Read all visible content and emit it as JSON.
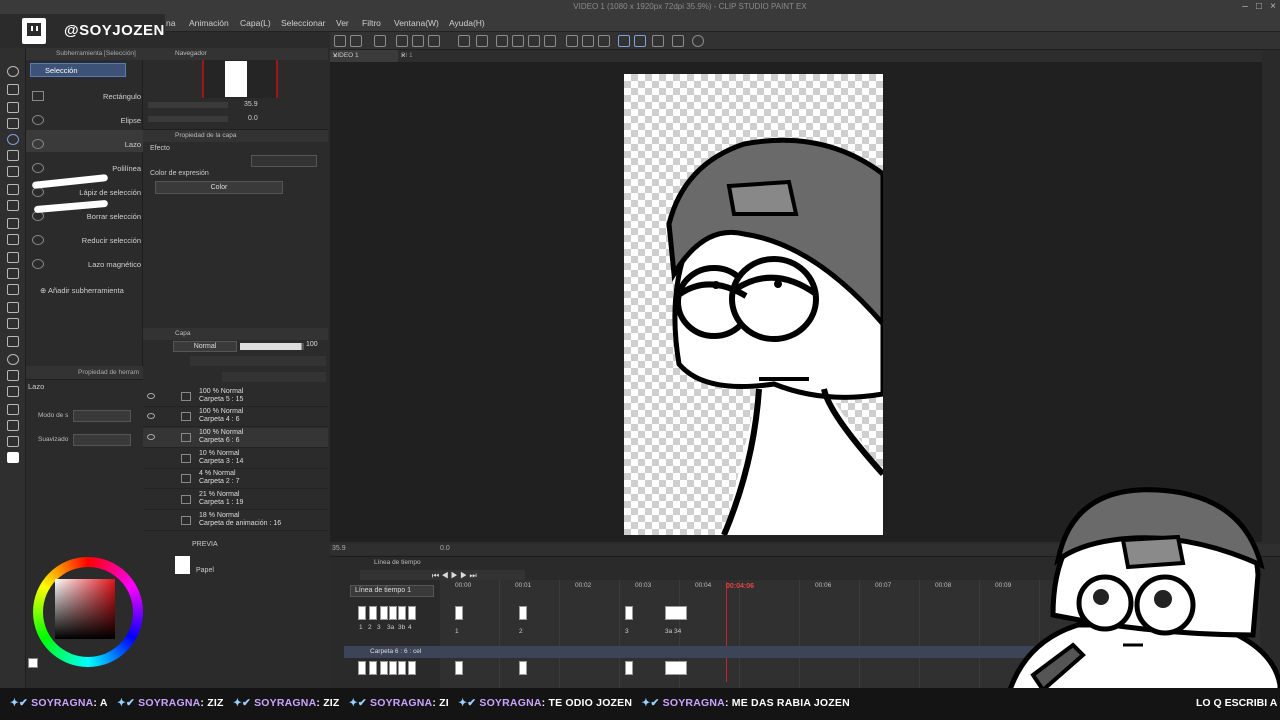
{
  "window": {
    "title": "VIDEO 1 (1080 x 1920px 72dpi 35.9%) - CLIP STUDIO PAINT EX"
  },
  "stream": {
    "handle": "@SOYJOZEN"
  },
  "menu": {
    "items": [
      "na",
      "Animación",
      "Capa(L)",
      "Seleccionar",
      "Ver",
      "Filtro",
      "Ventana(W)",
      "Ayuda(H)"
    ]
  },
  "subtool": {
    "header": "Subherramienta [Selección]",
    "group": "Selección",
    "items": [
      "Rectángulo",
      "Elipse",
      "Lazo",
      "Polilínea",
      "Lápiz de selección",
      "Borrar selección",
      "Reducir selección",
      "Lazo magnético"
    ],
    "add_label": "Añadir subherramienta"
  },
  "tool_property": {
    "header": "Propiedad de herram",
    "tool_name": "Lazo",
    "mode_label": "Modo de sel",
    "smoothing_label": "Suavizado"
  },
  "navigator": {
    "title": "Navegador",
    "zoom": "35.9",
    "rotation": "0.0"
  },
  "layer_property": {
    "title": "Propiedad de la capa",
    "effect_label": "Efecto",
    "expression_color_label": "Color de expresión",
    "expression_color_value": "Color"
  },
  "layers": {
    "title": "Capa",
    "blend_mode": "Normal",
    "opacity": "100",
    "rows": [
      {
        "mode": "100 % Normal",
        "name": "Carpeta 5 : 15"
      },
      {
        "mode": "100 % Normal",
        "name": "Carpeta 4 : 6"
      },
      {
        "mode": "100 % Normal",
        "name": "Carpeta 6 : 6"
      },
      {
        "mode": "10 % Normal",
        "name": "Carpeta 3 : 14"
      },
      {
        "mode": "4 % Normal",
        "name": "Carpeta 2 : 7"
      },
      {
        "mode": "21 % Normal",
        "name": "Carpeta 1 : 19"
      },
      {
        "mode": "18 % Normal",
        "name": "Carpeta de animación : 16"
      }
    ],
    "preview_label": "PREVIA",
    "paper_label": "Papel"
  },
  "document": {
    "tab1": "VIDEO 1",
    "tab2": "PI 1"
  },
  "canvas_status": {
    "zoom": "35.9",
    "angle": "0.0"
  },
  "timeline": {
    "title": "Línea de tiempo",
    "dropdown": "Línea de tiempo 1",
    "playhead": "00:04:06",
    "seconds": [
      "00:00",
      "00:01",
      "00:02",
      "00:03",
      "00:04",
      "00:06",
      "00:07",
      "00:08",
      "00:09"
    ],
    "track2_label": "Carpeta 6 : 6 : cel",
    "cel_numbers_top": [
      "1",
      "2",
      "3",
      "3a",
      "3b",
      "4"
    ],
    "cel_marks": [
      "1",
      "2",
      "3",
      "3a 34"
    ]
  },
  "ticker": {
    "messages": [
      {
        "user": "SOYRAGNA",
        "text": "A"
      },
      {
        "user": "SOYRAGNA",
        "text": "ZIZ"
      },
      {
        "user": "SOYRAGNA",
        "text": "ZIZ"
      },
      {
        "user": "SOYRAGNA",
        "text": "ZI"
      },
      {
        "user": "SOYRAGNA",
        "text": "TE ODIO JOZEN"
      },
      {
        "user": "SOYRAGNA",
        "text": "ME DAS RABIA JOZEN"
      }
    ],
    "tail": "LO Q ESCRIBI A"
  }
}
